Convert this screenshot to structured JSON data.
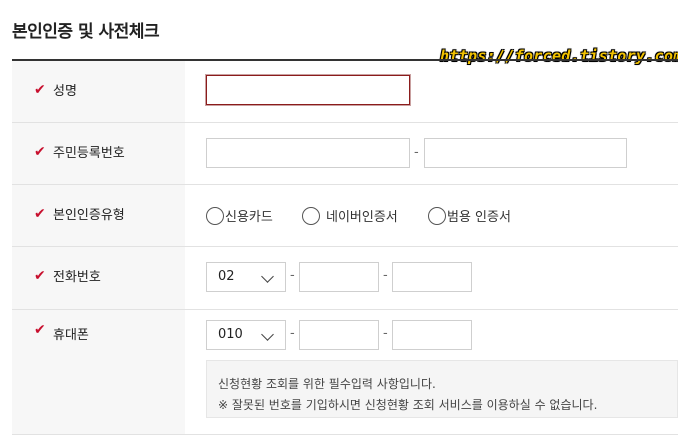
{
  "page": {
    "title": "본인인증 및 사전체크",
    "watermark": "https://forced.tistory.com"
  },
  "required_mark": "✔",
  "fields": {
    "name": {
      "label": "성명",
      "value": ""
    },
    "resident_number": {
      "label": "주민등록번호",
      "first": "",
      "second": "",
      "separator": "-"
    },
    "auth_type": {
      "label": "본인인증유형",
      "options": [
        "신용카드",
        "네이버인증서",
        "범용 인증서"
      ]
    },
    "phone": {
      "label": "전화번호",
      "area_code": "02",
      "middle": "",
      "last": "",
      "separator": "-"
    },
    "mobile": {
      "label": "휴대폰",
      "prefix": "010",
      "middle": "",
      "last": "",
      "separator": "-",
      "notice_line1": "신청현황 조회를 위한 필수입력 사항입니다.",
      "notice_line2": "※ 잘못된 번호를 기입하시면 신청현황 조회 서비스를 이용하실 수 없습니다."
    }
  },
  "colors": {
    "required": "#c8102e",
    "focus_border": "#8b1c1c",
    "watermark": "#f2c200"
  }
}
